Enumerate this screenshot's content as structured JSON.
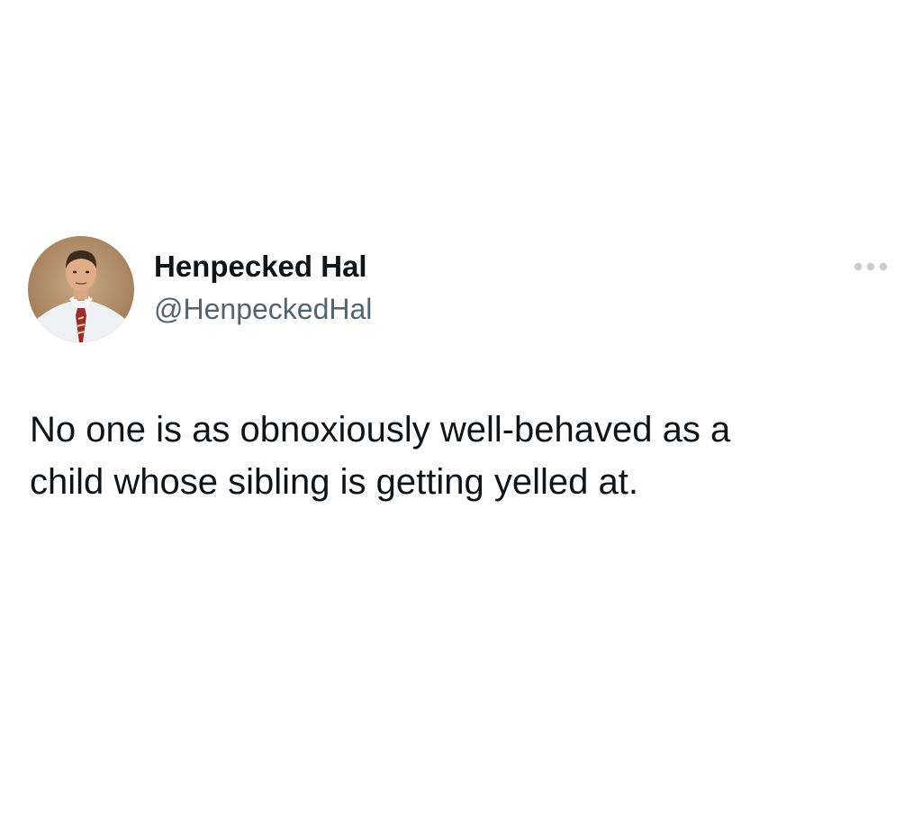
{
  "tweet": {
    "author": {
      "display_name": "Henpecked Hal",
      "handle": "@HenpeckedHal",
      "avatar_icon": "profile-photo"
    },
    "more_icon": "more-horizontal-icon",
    "text": "No one is as obnoxiously well-behaved as a\nchild whose sibling is getting yelled at."
  },
  "colors": {
    "text_primary": "#0f1419",
    "text_secondary": "#536471",
    "background": "#ffffff"
  }
}
